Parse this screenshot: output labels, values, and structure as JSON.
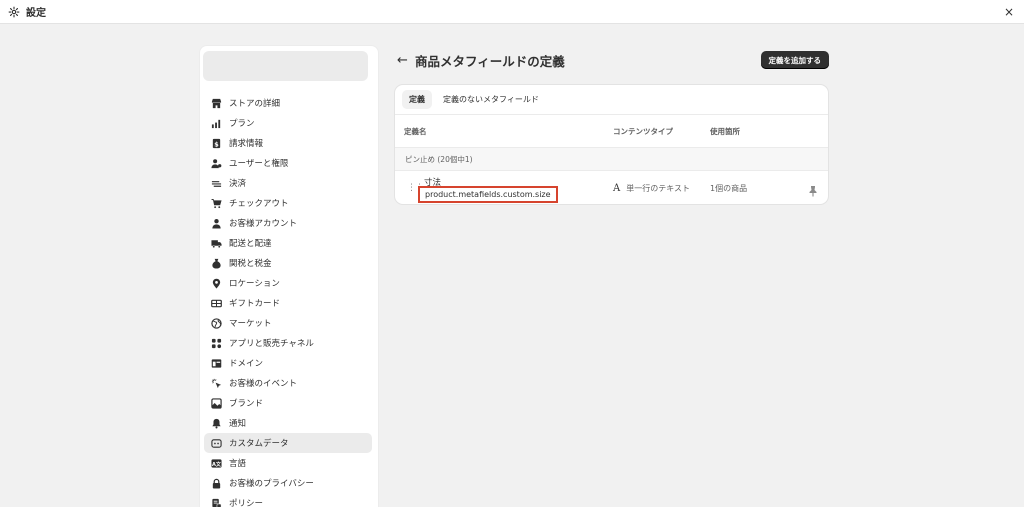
{
  "window": {
    "title": "設定",
    "close_label": "×"
  },
  "sidebar": {
    "items": [
      {
        "label": "ストアの詳細",
        "icon": "store-icon"
      },
      {
        "label": "プラン",
        "icon": "plan-chart-icon"
      },
      {
        "label": "請求情報",
        "icon": "billing-icon"
      },
      {
        "label": "ユーザーと権限",
        "icon": "users-icon"
      },
      {
        "label": "決済",
        "icon": "payments-icon"
      },
      {
        "label": "チェックアウト",
        "icon": "cart-icon"
      },
      {
        "label": "お客様アカウント",
        "icon": "person-icon"
      },
      {
        "label": "配送と配達",
        "icon": "truck-icon"
      },
      {
        "label": "関税と税金",
        "icon": "money-bag-icon"
      },
      {
        "label": "ロケーション",
        "icon": "location-icon"
      },
      {
        "label": "ギフトカード",
        "icon": "gift-card-icon"
      },
      {
        "label": "マーケット",
        "icon": "globe-icon"
      },
      {
        "label": "アプリと販売チャネル",
        "icon": "apps-icon"
      },
      {
        "label": "ドメイン",
        "icon": "domain-icon"
      },
      {
        "label": "お客様のイベント",
        "icon": "cursor-click-icon"
      },
      {
        "label": "ブランド",
        "icon": "brand-icon"
      },
      {
        "label": "通知",
        "icon": "bell-icon"
      },
      {
        "label": "カスタムデータ",
        "icon": "custom-data-icon",
        "active": true
      },
      {
        "label": "言語",
        "icon": "language-icon"
      },
      {
        "label": "お客様のプライバシー",
        "icon": "lock-icon"
      },
      {
        "label": "ポリシー",
        "icon": "policy-icon"
      }
    ]
  },
  "header": {
    "back_label": "←",
    "title": "商品メタフィールドの定義",
    "add_button": "定義を追加する"
  },
  "tabs": [
    {
      "label": "定義",
      "active": true
    },
    {
      "label": "定義のないメタフィールド",
      "active": false
    }
  ],
  "table": {
    "columns": {
      "name": "定義名",
      "type": "コンテンツタイプ",
      "usage": "使用箇所"
    },
    "pinned_label": "ピン止め (20個中1)",
    "rows": [
      {
        "name": "寸法",
        "key": "product.metafields.custom.size",
        "type_icon": "A",
        "type": "単一行のテキスト",
        "usage": "1個の商品"
      }
    ]
  },
  "colors": {
    "highlight_border": "#d6442e",
    "primary_button": "#303030",
    "background": "#f1f1f1"
  }
}
